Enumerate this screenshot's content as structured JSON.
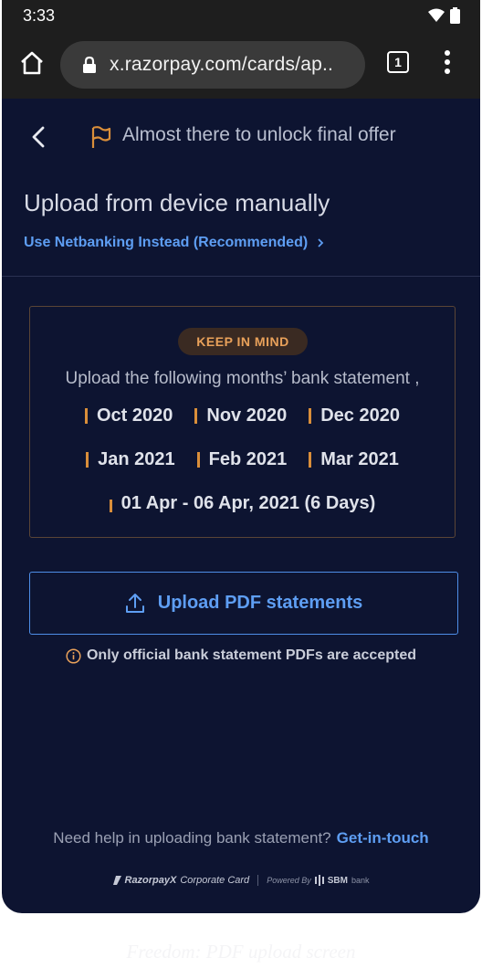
{
  "status_bar": {
    "time": "3:33"
  },
  "browser": {
    "url": "x.razorpay.com/cards/ap..",
    "tab_count": "1"
  },
  "header": {
    "title": "Almost there to unlock final offer"
  },
  "page": {
    "heading": "Upload from device manually",
    "netbanking_link": "Use Netbanking Instead (Recommended)"
  },
  "keep_in_mind": {
    "badge": "KEEP IN MIND",
    "instruction": "Upload the following months’ bank statement ,",
    "row1": [
      "Oct 2020",
      "Nov 2020",
      "Dec 2020"
    ],
    "row2": [
      "Jan 2021",
      "Feb 2021",
      "Mar 2021"
    ],
    "partial": "01 Apr - 06 Apr, 2021 (6 Days)"
  },
  "upload": {
    "button_label": "Upload PDF statements",
    "note": "Only official bank statement PDFs are accepted"
  },
  "help": {
    "text": "Need help in uploading bank statement?",
    "link": "Get-in-touch"
  },
  "footer": {
    "brand": "RazorpayX",
    "product": "Corporate Card",
    "powered_by": "Powered By",
    "partner": "SBM",
    "partner_suffix": "bank"
  },
  "caption": "Freedom: PDF upload screen",
  "colors": {
    "background": "#0d1431",
    "accent": "#5e9ef3",
    "highlight": "#d98e3a"
  }
}
